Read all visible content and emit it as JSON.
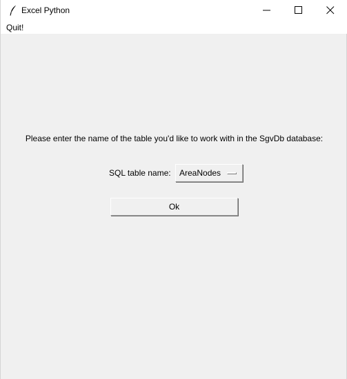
{
  "window": {
    "title": "Excel Python",
    "icon": "feather-icon"
  },
  "menubar": {
    "items": [
      {
        "label": "Quit!"
      }
    ]
  },
  "main": {
    "prompt": "Please enter the name of the table you'd like to work with in the SgvDb database:",
    "table_label": "SQL table name:",
    "table_select": {
      "value": "AreaNodes"
    },
    "ok_label": "Ok"
  },
  "colors": {
    "background": "#f0f0f0",
    "titlebar": "#ffffff"
  }
}
